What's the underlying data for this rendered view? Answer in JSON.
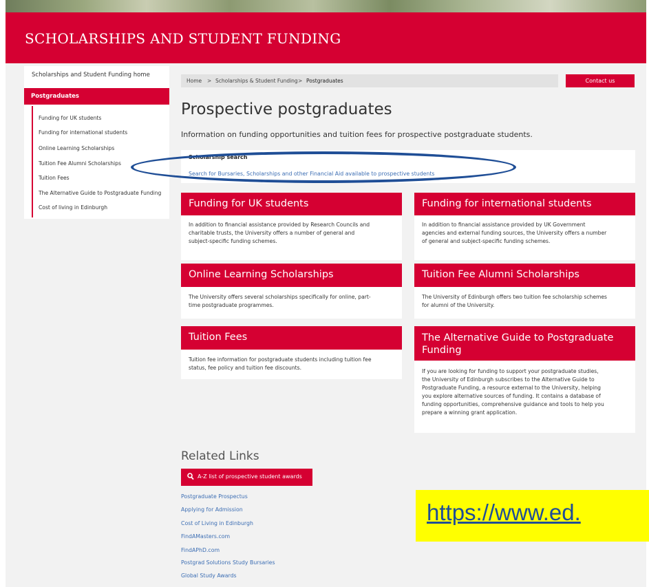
{
  "header": {
    "title": "SCHOLARSHIPS AND STUDENT FUNDING"
  },
  "sidebar": {
    "home": "Scholarships and Student Funding home",
    "active": "Postgraduates",
    "items": [
      "Funding for UK students",
      "Funding for international students",
      "Online Learning Scholarships",
      "Tuition Fee Alumni Scholarships",
      "Tuition Fees",
      "The Alternative Guide to Postgraduate Funding",
      "Cost of living in Edinburgh"
    ]
  },
  "breadcrumb": {
    "home": "Home",
    "sep1": ">",
    "section": "Scholarships & Student Funding",
    "sep2": ">",
    "current": "Postgraduates"
  },
  "contact_label": "Contact us",
  "page_title": "Prospective postgraduates",
  "intro": "Information on funding opportunities and tuition fees for prospective postgraduate students.",
  "search": {
    "label": "Scholarship search",
    "link": "Search for Bursaries, Scholarships and other Financial Aid available to prospective students"
  },
  "cards": [
    {
      "title": "Funding for UK students",
      "body": [
        "In addition to financial assistance provided by Research Councils and",
        "charitable trusts, the University offers a number of general and",
        "subject-specific funding schemes."
      ]
    },
    {
      "title": "Funding for international students",
      "body": [
        "In addition to financial assistance provided by UK Government",
        "agencies and external funding sources, the University offers a number",
        "of general and subject-specific funding schemes."
      ]
    },
    {
      "title": "Online Learning Scholarships",
      "body": [
        "The University offers several scholarships specifically for online, part-",
        "time postgraduate programmes."
      ]
    },
    {
      "title": "Tuition Fee Alumni Scholarships",
      "body": [
        "The University of Edinburgh offers two tuition fee scholarship schemes",
        "for alumni of the University."
      ]
    },
    {
      "title": "Tuition Fees",
      "body": [
        "Tuition fee information for postgraduate students including tuition fee",
        "status, fee policy and tuition fee discounts."
      ]
    },
    {
      "title_lines": [
        "The Alternative Guide to Postgraduate",
        "Funding"
      ],
      "body": [
        "If you are looking for funding to support your postgraduate studies,",
        "the University of Edinburgh subscribes to the Alternative Guide to",
        "Postgraduate Funding, a resource external to the University, helping",
        "you explore alternative sources of funding. It contains a database of",
        "funding opportunities, comprehensive guidance and tools to help you",
        "prepare a winning grant application."
      ]
    }
  ],
  "related": {
    "title": "Related Links",
    "button": "A-Z list of prospective student awards",
    "links": [
      "Postgraduate Prospectus",
      "Applying for Admission",
      "Cost of Living in Edinburgh",
      "FindAMasters.com",
      "FindAPhD.com",
      "Postgrad Solutions Study Bursaries",
      "Global Study Awards"
    ]
  },
  "overlay_url": "https://www.ed.",
  "colors": {
    "brand_red": "#d50032",
    "link_blue": "#3b6db3",
    "oval_blue": "#1f4e96",
    "highlight": "#ffff00"
  }
}
